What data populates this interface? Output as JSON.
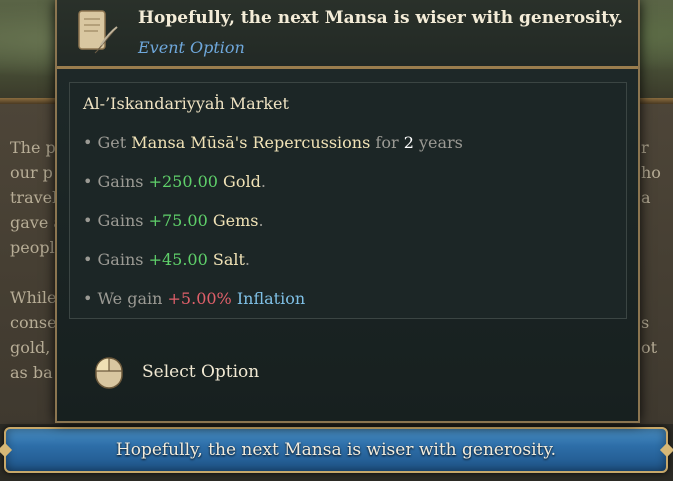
{
  "tooltip": {
    "title": "Hopefully, the next Mansa is wiser with generosity.",
    "subtitle": "Event Option",
    "effects_title": "Al-’Iskandariyyaḣ Market",
    "effects": [
      {
        "prefix": "• Get ",
        "name": "Mansa Mūsā's Repercussions",
        "mid": " for ",
        "value": "2",
        "suffix": " years"
      },
      {
        "prefix": "• Gains ",
        "value": "+250.00",
        "name": "Gold",
        "suffix": "."
      },
      {
        "prefix": "• Gains ",
        "value": "+75.00",
        "name": "Gems",
        "suffix": "."
      },
      {
        "prefix": "• Gains ",
        "value": "+45.00",
        "name": "Salt",
        "suffix": "."
      },
      {
        "prefix": "• We gain ",
        "value": "+5.00%",
        "name": "Inflation"
      }
    ],
    "select_label": "Select Option",
    "icons": {
      "header": "scroll-quill-icon",
      "select": "mouse-left-click-icon"
    }
  },
  "background": {
    "left_fragments": [
      "The p",
      "our p",
      "travel",
      "gave a",
      "peopl",
      "While",
      "conse",
      "gold, ",
      "as ba"
    ],
    "right_fragments": [
      "r",
      "ho",
      "a",
      "s",
      "ot"
    ]
  },
  "option_button": {
    "label": "Hopefully, the next Mansa is wiser with generosity."
  },
  "colors": {
    "accent_gold": "#c7a86a",
    "positive": "#5fd06a",
    "negative": "#e0606a",
    "link_blue": "#7fc0e6",
    "button_blue": "#2d6ea8"
  }
}
